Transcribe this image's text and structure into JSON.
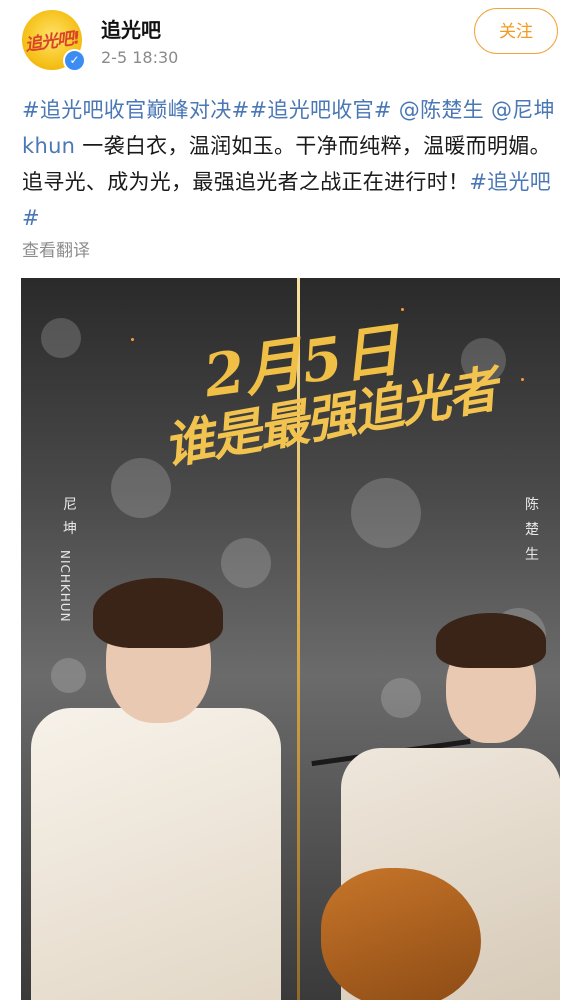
{
  "account": {
    "name": "追光吧",
    "avatar_text": "追光吧!",
    "verified_badge": "✓",
    "date": "2-5",
    "time": "18:30"
  },
  "follow_label": "关注",
  "post": {
    "tag1": "#追光吧收官巅峰对决#",
    "tag2": "#追光吧收官#",
    "mention1": "@陈楚生",
    "mention2": "@尼坤 khun",
    "body": "一袭白衣，温润如玉。干净而纯粹，温暖而明媚。追寻光、成为光，最强追光者之战正在进行时！",
    "tag3": "#追光吧#"
  },
  "translate_label": "查看翻译",
  "poster": {
    "date_text": "2月5日",
    "slogan": "谁是最强追光者",
    "left_name_cn": [
      "尼",
      "坤"
    ],
    "left_name_en": "NICHKHUN",
    "right_name_cn": [
      "陈",
      "楚",
      "生"
    ]
  },
  "colors": {
    "link_blue": "#4a77b5",
    "follow_orange": "#f39a1f",
    "poster_gold": "#f0bf46",
    "verified_blue": "#3b8cf3"
  }
}
